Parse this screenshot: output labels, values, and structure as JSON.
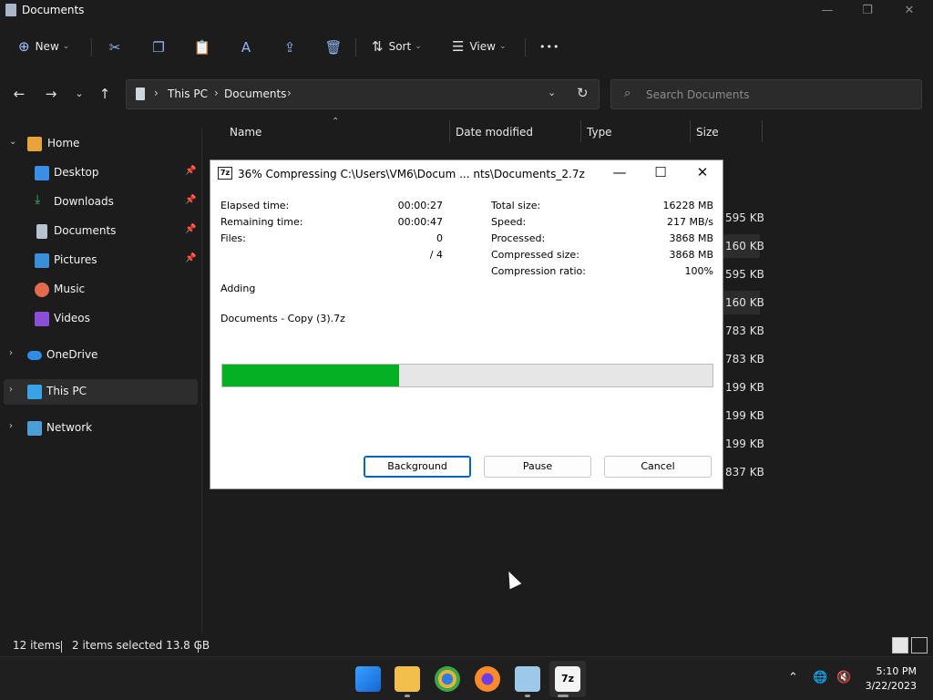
{
  "window": {
    "title": "Documents",
    "minimize": "—",
    "maximize": "❐",
    "close": "✕"
  },
  "toolbar": {
    "new_label": "New",
    "sort_label": "Sort",
    "view_label": "View",
    "more": "•••"
  },
  "address": {
    "crumbs": [
      "This PC",
      "Documents"
    ],
    "search_placeholder": "Search Documents"
  },
  "sidebar": {
    "items": [
      {
        "label": "Home",
        "icon": "home-icon",
        "expand": "⌄"
      },
      {
        "label": "Desktop",
        "icon": "desktop-icon",
        "pinned": true
      },
      {
        "label": "Downloads",
        "icon": "downloads-icon",
        "pinned": true
      },
      {
        "label": "Documents",
        "icon": "documents-icon",
        "pinned": true
      },
      {
        "label": "Pictures",
        "icon": "pictures-icon",
        "pinned": true
      },
      {
        "label": "Music",
        "icon": "music-icon"
      },
      {
        "label": "Videos",
        "icon": "videos-icon"
      },
      {
        "label": "OneDrive",
        "icon": "onedrive-icon",
        "expand": "›"
      },
      {
        "label": "This PC",
        "icon": "this-pc-icon",
        "expand": "›",
        "selected": true
      },
      {
        "label": "Network",
        "icon": "network-icon",
        "expand": "›"
      }
    ]
  },
  "columns": {
    "name": "Name",
    "date": "Date modified",
    "type": "Type",
    "size": "Size"
  },
  "sizes": [
    "595 KB",
    "160 KB",
    "595 KB",
    "160 KB",
    "783 KB",
    "783 KB",
    "199 KB",
    "199 KB",
    "199 KB",
    "837 KB"
  ],
  "status": {
    "items": "12 items",
    "selected": "2 items selected  13.8 GB"
  },
  "dialog": {
    "title": "36% Compressing C:\\Users\\VM6\\Docum ... nts\\Documents_2.7z",
    "left": [
      {
        "label": "Elapsed time:",
        "value": "00:00:27"
      },
      {
        "label": "Remaining time:",
        "value": "00:00:47"
      },
      {
        "label": "Files:",
        "value": "0"
      },
      {
        "label": "",
        "value": "/ 4"
      }
    ],
    "right": [
      {
        "label": "Total size:",
        "value": "16228 MB"
      },
      {
        "label": "Speed:",
        "value": "217 MB/s"
      },
      {
        "label": "Processed:",
        "value": "3868 MB"
      },
      {
        "label": "Compressed size:",
        "value": "3868 MB"
      },
      {
        "label": "Compression ratio:",
        "value": "100%"
      }
    ],
    "action": "Adding",
    "current_file": "Documents - Copy (3).7z",
    "progress": 0.36,
    "buttons": {
      "background": "Background",
      "pause": "Pause",
      "cancel": "Cancel"
    }
  },
  "taskbar": {
    "time": "5:10 PM",
    "date": "3/22/2023"
  },
  "colors": {
    "progress": "#06b025",
    "accent": "#0067c0"
  }
}
